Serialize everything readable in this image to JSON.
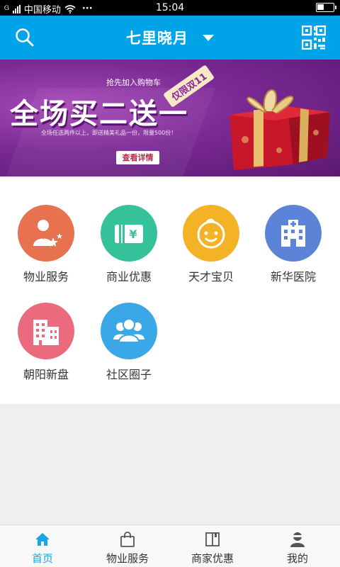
{
  "status_bar": {
    "carrier": "中国移动",
    "more": "···",
    "time": "15:04"
  },
  "header": {
    "title": "七里晓月"
  },
  "banner": {
    "headline": "全场买二送一",
    "tagline": "抢先加入购物车",
    "tag": "仅限双11",
    "detail": "全场任选两件以上，即送精美礼品一份，限量500份！",
    "button_label": "查看详情",
    "slide_count": 3,
    "active_slide": 1
  },
  "services": [
    {
      "label": "物业服务",
      "icon": "property-service-icon",
      "color": "#e8714f"
    },
    {
      "label": "商业优惠",
      "icon": "coupon-icon",
      "color": "#35c19a"
    },
    {
      "label": "天才宝贝",
      "icon": "baby-face-icon",
      "color": "#f4b227"
    },
    {
      "label": "新华医院",
      "icon": "hospital-icon",
      "color": "#5b84d8"
    },
    {
      "label": "朝阳新盘",
      "icon": "building-icon",
      "color": "#ec6a7e"
    },
    {
      "label": "社区圈子",
      "icon": "community-icon",
      "color": "#3aa8e6"
    }
  ],
  "bottom_nav": [
    {
      "label": "首页",
      "icon": "home-icon",
      "active": true
    },
    {
      "label": "物业服务",
      "icon": "shopping-bag-icon",
      "active": false
    },
    {
      "label": "商家优惠",
      "icon": "book-icon",
      "active": false
    },
    {
      "label": "我的",
      "icon": "user-icon",
      "active": false
    }
  ],
  "colors": {
    "header": "#00a3e8",
    "nav_active": "#1aa6e6"
  }
}
